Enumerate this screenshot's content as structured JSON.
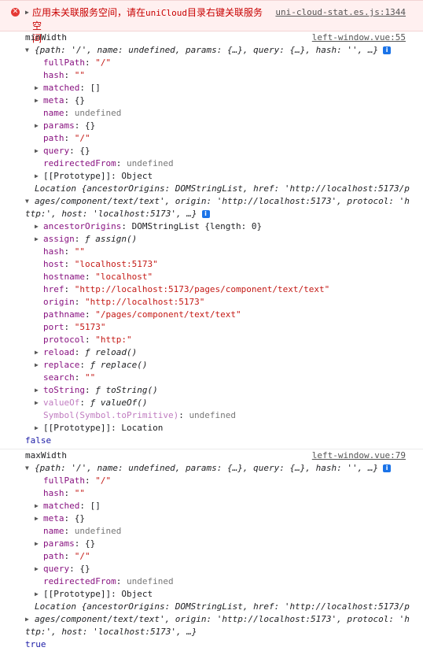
{
  "error": {
    "text_cn": "应用未关联服务空间，请在",
    "text_hl": "uniCloud",
    "text_cn2": "目录右键关联服务空",
    "text_end": "间",
    "source": "uni-cloud-stat.es.js:1344"
  },
  "min": {
    "label": "minWidth",
    "source": "left-window.vue:55",
    "route_summary": "{path: '/', name: undefined, params: {…}, query: {…}, hash: '', …}",
    "props": {
      "fullPath": "\"/\"",
      "hash": "\"\"",
      "matched": "[]",
      "meta": "{}",
      "name": "undefined",
      "params": "{}",
      "path": "\"/\"",
      "query": "{}",
      "redirectedFrom": "undefined",
      "proto": "Object"
    },
    "location_summary_1": "Location {ancestorOrigins: DOMStringList, href: 'http://localhost:5173/p",
    "location_summary_2": "ages/component/text/text', origin: 'http://localhost:5173', protocol: 'h",
    "location_summary_3": "ttp:', host: 'localhost:5173', …}",
    "location": {
      "ancestorOrigins": "DOMStringList {length: 0}",
      "assign": "ƒ assign()",
      "hash": "\"\"",
      "host": "\"localhost:5173\"",
      "hostname": "\"localhost\"",
      "href": "\"http://localhost:5173/pages/component/text/text\"",
      "origin": "\"http://localhost:5173\"",
      "pathname": "\"/pages/component/text/text\"",
      "port": "\"5173\"",
      "protocol": "\"http:\"",
      "reload": "ƒ reload()",
      "replace": "ƒ replace()",
      "search": "\"\"",
      "toString": "ƒ toString()",
      "valueOf": "ƒ valueOf()",
      "toPrimitive_key": "Symbol(Symbol.toPrimitive)",
      "toPrimitive": "undefined",
      "proto": "Location"
    },
    "result": "false"
  },
  "max": {
    "label": "maxWidth",
    "source": "left-window.vue:79",
    "route_summary": "{path: '/', name: undefined, params: {…}, query: {…}, hash: '', …}",
    "props": {
      "fullPath": "\"/\"",
      "hash": "\"\"",
      "matched": "[]",
      "meta": "{}",
      "name": "undefined",
      "params": "{}",
      "path": "\"/\"",
      "query": "{}",
      "redirectedFrom": "undefined",
      "proto": "Object"
    },
    "location_summary_1": "Location {ancestorOrigins: DOMStringList, href: 'http://localhost:5173/p",
    "location_summary_2": "ages/component/text/text', origin: 'http://localhost:5173', protocol: 'h",
    "location_summary_3": "ttp:', host: 'localhost:5173', …}",
    "result": "true"
  },
  "labels": {
    "fullPath": "fullPath",
    "hash": "hash",
    "matched": "matched",
    "meta": "meta",
    "name": "name",
    "params": "params",
    "path": "path",
    "query": "query",
    "redirectedFrom": "redirectedFrom",
    "proto": "[[Prototype]]",
    "ancestorOrigins": "ancestorOrigins",
    "assign": "assign",
    "host": "host",
    "hostname": "hostname",
    "href": "href",
    "origin": "origin",
    "pathname": "pathname",
    "port": "port",
    "protocol": "protocol",
    "reload": "reload",
    "replace": "replace",
    "search": "search",
    "toString": "toString",
    "valueOf": "valueOf",
    "colon": ":"
  },
  "icons": {
    "error": "error-icon",
    "info": "info-icon",
    "expand": "expand-triangle-icon"
  }
}
